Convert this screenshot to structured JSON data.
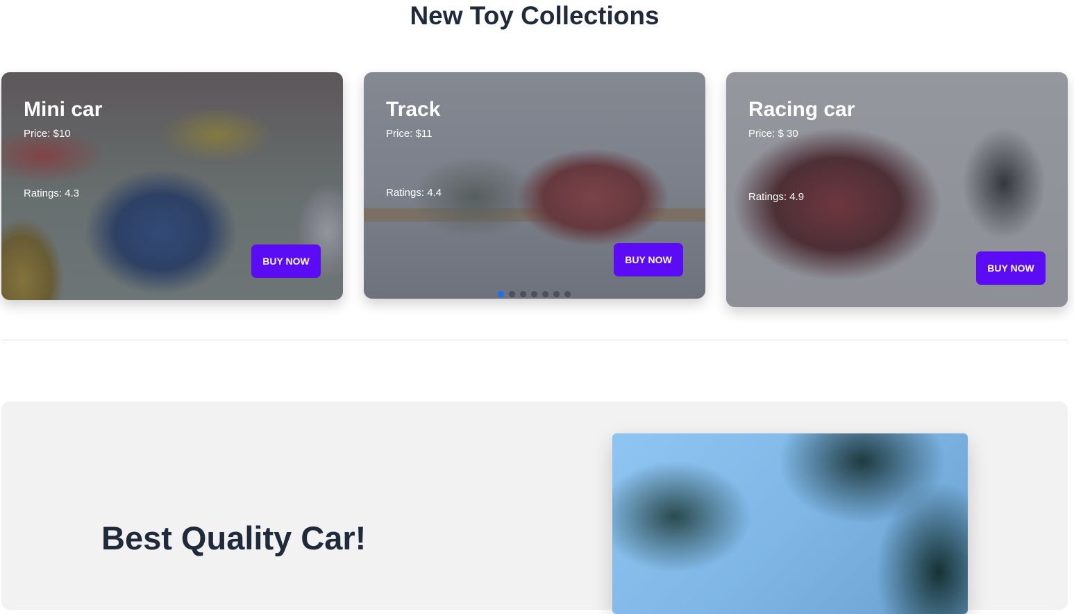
{
  "section_title": "New Toy Collections",
  "cards": [
    {
      "title": "Mini car",
      "price": "Price: $10",
      "rating": "Ratings: 4.3",
      "button": "BUY NOW"
    },
    {
      "title": "Track",
      "price": "Price: $11",
      "rating": "Ratings: 4.4",
      "button": "BUY NOW"
    },
    {
      "title": "Racing car",
      "price": "Price: $ 30",
      "rating": "Ratings: 4.9",
      "button": "BUY NOW"
    }
  ],
  "carousel": {
    "dot_count": 7,
    "active_index": 0
  },
  "promo": {
    "heading": "Best Quality Car!"
  },
  "colors": {
    "accent": "#5b0cf5",
    "active_dot": "#1e6ff0",
    "heading": "#1f2a3b",
    "promo_bg": "#f2f2f2"
  }
}
